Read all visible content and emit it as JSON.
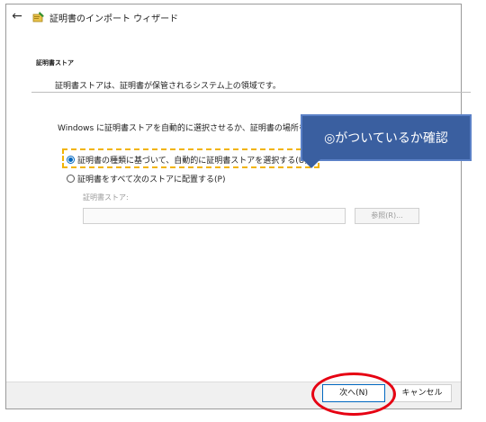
{
  "window": {
    "title": "証明書のインポート ウィザード"
  },
  "page": {
    "section_heading": "証明書ストア",
    "section_description": "証明書ストアは、証明書が保管されるシステム上の領域です。",
    "instruction": "Windows に証明書ストアを自動的に選択させるか、証明書の場所を指定してください。",
    "options": [
      {
        "label": "証明書の種類に基づいて、自動的に証明書ストアを選択する(U)",
        "selected": true
      },
      {
        "label": "証明書をすべて次のストアに配置する(P)",
        "selected": false
      }
    ],
    "store_label": "証明書ストア:",
    "store_value": "",
    "browse_label": "参照(R)..."
  },
  "footer": {
    "next_label": "次へ(N)",
    "cancel_label": "キャンセル"
  },
  "annotation": {
    "callout_text": "◎がついているか確認"
  },
  "colors": {
    "accent": "#0067c0",
    "highlight": "#f2b400",
    "callout_bg": "#3a5fa0",
    "circle": "#e60012"
  }
}
